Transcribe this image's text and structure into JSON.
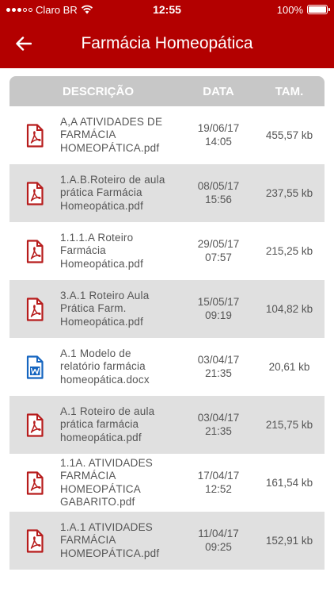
{
  "status": {
    "carrier": "Claro BR",
    "time": "12:55",
    "battery": "100%"
  },
  "header": {
    "title": "Farmácia Homeopática"
  },
  "colors": {
    "brand": "#b30000",
    "pdf": "#b71c1c",
    "word": "#1565c0",
    "table_header": "#c7c7c7",
    "row_alt": "#e0e0e0"
  },
  "table": {
    "columns": [
      "DESCRIÇÃO",
      "DATA",
      "TAM."
    ],
    "rows": [
      {
        "icon": "pdf-icon",
        "desc": [
          "A,A ATIVIDADES DE",
          "FARMÁCIA",
          "HOMEOPÁTICA.pdf"
        ],
        "date": "19/06/17",
        "time": "14:05",
        "size": "455,57 kb"
      },
      {
        "icon": "pdf-icon",
        "desc": [
          "1.A.B.Roteiro de aula",
          "prática Farmácia",
          "Homeopática.pdf"
        ],
        "date": "08/05/17",
        "time": "15:56",
        "size": "237,55 kb"
      },
      {
        "icon": "pdf-icon",
        "desc": [
          "1.1.1.A Roteiro",
          "Farmácia",
          "Homeopática.pdf"
        ],
        "date": "29/05/17",
        "time": "07:57",
        "size": "215,25 kb"
      },
      {
        "icon": "pdf-icon",
        "desc": [
          "3.A.1 Roteiro Aula",
          "Prática Farm.",
          "Homeopática.pdf"
        ],
        "date": "15/05/17",
        "time": "09:19",
        "size": "104,82 kb"
      },
      {
        "icon": "word-icon",
        "desc": [
          "A.1 Modelo de",
          "relatório farmácia",
          "homeopática.docx"
        ],
        "date": "03/04/17",
        "time": "21:35",
        "size": "20,61 kb"
      },
      {
        "icon": "pdf-icon",
        "desc": [
          "A.1 Roteiro de aula",
          "prática farmácia",
          "homeopática.pdf"
        ],
        "date": "03/04/17",
        "time": "21:35",
        "size": "215,75 kb"
      },
      {
        "icon": "pdf-icon",
        "desc": [
          "1.1A. ATIVIDADES",
          "FARMÁCIA",
          "HOMEOPÁTICA",
          "GABARITO.pdf"
        ],
        "date": "17/04/17",
        "time": "12:52",
        "size": "161,54 kb"
      },
      {
        "icon": "pdf-icon",
        "desc": [
          "1.A.1 ATIVIDADES",
          "FARMÁCIA",
          "HOMEOPÁTICA.pdf"
        ],
        "date": "11/04/17",
        "time": "09:25",
        "size": "152,91 kb"
      }
    ]
  }
}
